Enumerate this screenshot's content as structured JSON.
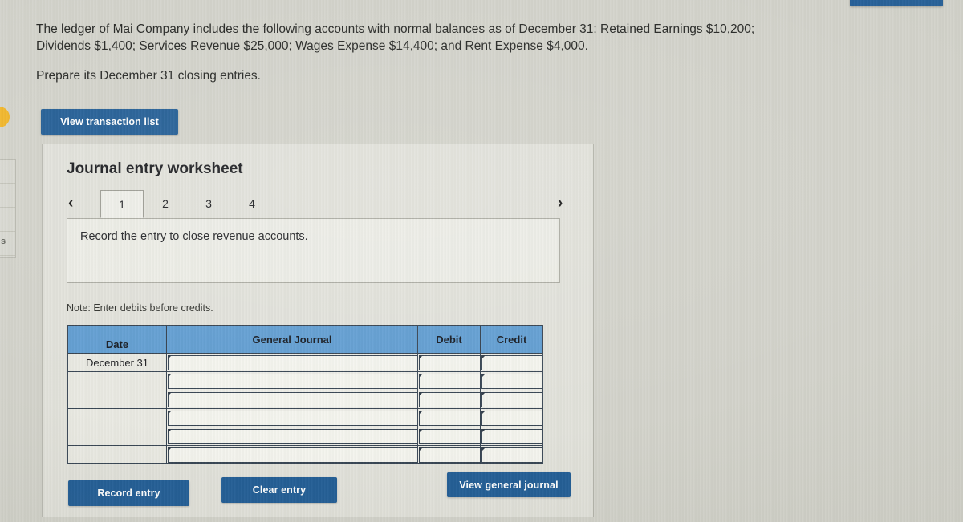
{
  "question": {
    "line1": "The ledger of Mai Company includes the following accounts with normal balances as of December 31: Retained Earnings $10,200;",
    "line2": "Dividends $1,400; Services Revenue $25,000; Wages Expense $14,400; and Rent Expense $4,000.",
    "prepare": "Prepare its December 31 closing entries."
  },
  "toolbar": {
    "view_transaction_list": "View transaction list"
  },
  "worksheet": {
    "title": "Journal entry worksheet",
    "prev_arrow": "‹",
    "next_arrow": "›",
    "tabs": [
      {
        "label": "1",
        "active": true
      },
      {
        "label": "2",
        "active": false
      },
      {
        "label": "3",
        "active": false
      },
      {
        "label": "4",
        "active": false
      }
    ],
    "instruction": "Record the entry to close revenue accounts.",
    "note": "Note: Enter debits before credits."
  },
  "journal": {
    "columns": [
      "Date",
      "General Journal",
      "Debit",
      "Credit"
    ],
    "rows": [
      {
        "date": "December 31",
        "general_journal": "",
        "debit": "",
        "credit": ""
      },
      {
        "date": "",
        "general_journal": "",
        "debit": "",
        "credit": ""
      },
      {
        "date": "",
        "general_journal": "",
        "debit": "",
        "credit": ""
      },
      {
        "date": "",
        "general_journal": "",
        "debit": "",
        "credit": ""
      },
      {
        "date": "",
        "general_journal": "",
        "debit": "",
        "credit": ""
      },
      {
        "date": "",
        "general_journal": "",
        "debit": "",
        "credit": ""
      }
    ]
  },
  "actions": {
    "record_entry": "Record entry",
    "clear_entry": "Clear entry",
    "view_general_journal": "View general journal"
  },
  "colors": {
    "button_blue": "#1c5993",
    "table_header_blue": "#5d9bd1",
    "page_background": "#d2d2ca",
    "accent_yellow": "#f0b323"
  }
}
